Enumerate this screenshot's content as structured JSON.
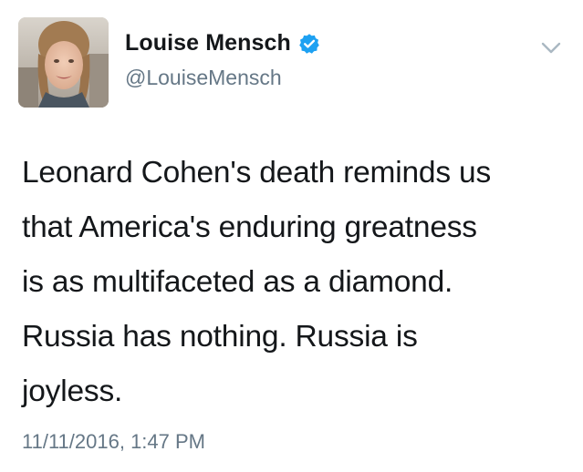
{
  "author": {
    "display_name": "Louise Mensch",
    "handle": "@LouiseMensch",
    "verified": true
  },
  "tweet": {
    "text_lines": [
      "Leonard Cohen's death reminds us",
      "that America's enduring greatness",
      "is as multifaceted as a diamond.",
      "Russia has nothing. Russia is",
      "joyless."
    ],
    "timestamp": "11/11/2016, 1:47 PM"
  },
  "icons": {
    "verified": "verified-badge-icon",
    "menu": "chevron-down-icon"
  },
  "colors": {
    "name": "#14171a",
    "secondary": "#657786",
    "verified_blue": "#1da1f2",
    "caret": "#aab8c2"
  }
}
